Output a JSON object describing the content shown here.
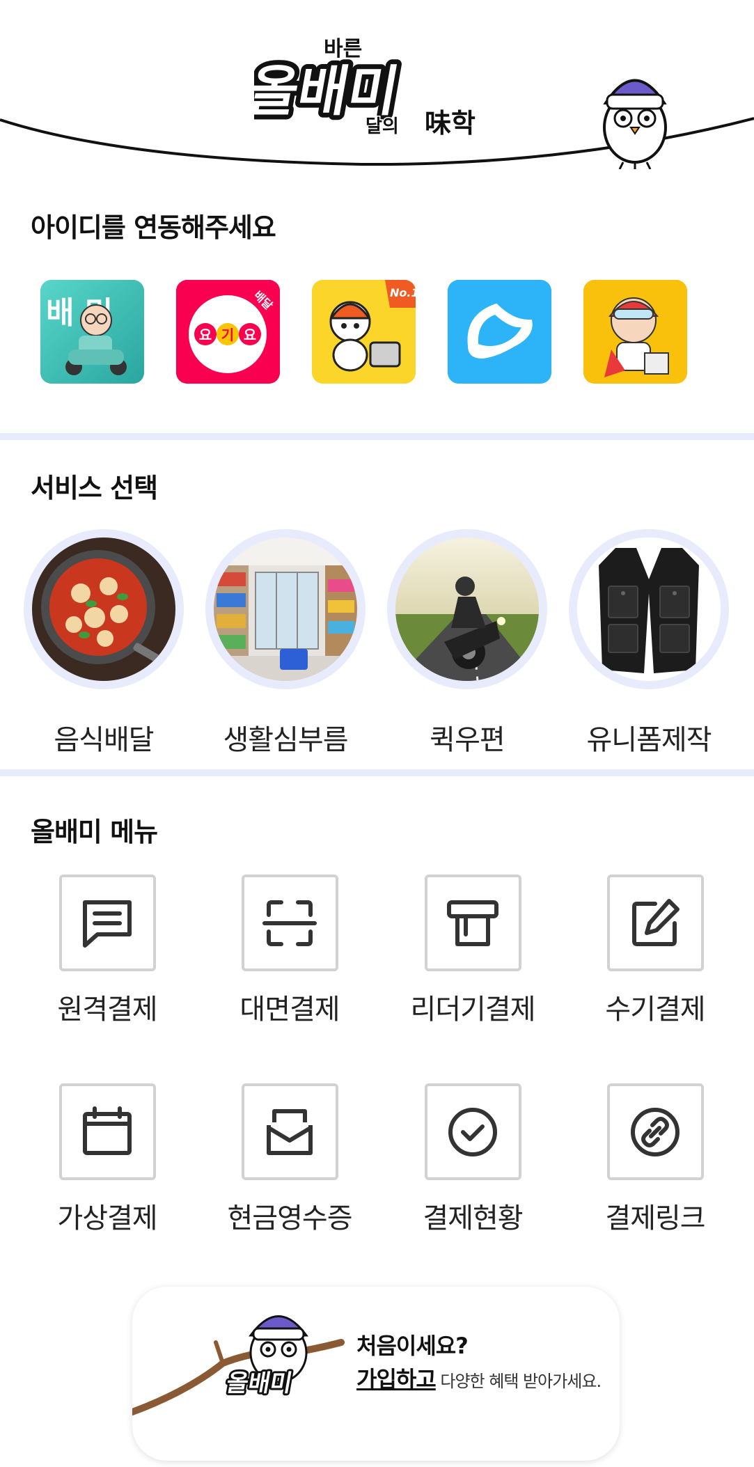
{
  "header": {
    "logo_small_top": "바른",
    "logo_main": "올배미",
    "logo_suffix_small": "달의",
    "logo_suffix_main": "味학"
  },
  "link_section": {
    "title": "아이디를 연동해주세요",
    "apps": [
      {
        "name": "배민",
        "color": "#3ec2b8"
      },
      {
        "name": "요기요",
        "color": "#fa0050"
      },
      {
        "name": "No.1 배달대행",
        "color": "#fbd52a"
      },
      {
        "name": "날개 앱",
        "color": "#2db4f8"
      },
      {
        "name": "캐릭터 앱",
        "color": "#f9c10c"
      }
    ],
    "app_texts": {
      "baemin": "배 민",
      "yogiyo_badge": "배달",
      "yogiyo_letters": [
        "요",
        "기",
        "요"
      ],
      "no1": "No.1"
    }
  },
  "services": {
    "title": "서비스 선택",
    "items": [
      {
        "label": "음식배달",
        "icon": "food-photo"
      },
      {
        "label": "생활심부름",
        "icon": "store-photo"
      },
      {
        "label": "퀵우편",
        "icon": "motorcycle-photo"
      },
      {
        "label": "유니폼제작",
        "icon": "vest-photo"
      }
    ]
  },
  "menu": {
    "title": "올배미 메뉴",
    "items": [
      {
        "label": "원격결제",
        "icon": "chat-icon"
      },
      {
        "label": "대면결제",
        "icon": "scan-icon"
      },
      {
        "label": "리더기결제",
        "icon": "card-reader-icon"
      },
      {
        "label": "수기결제",
        "icon": "edit-icon"
      },
      {
        "label": "가상결제",
        "icon": "calendar-icon"
      },
      {
        "label": "현금영수증",
        "icon": "envelope-icon"
      },
      {
        "label": "결제현황",
        "icon": "check-circle-icon"
      },
      {
        "label": "결제링크",
        "icon": "link-icon"
      }
    ]
  },
  "signup": {
    "question": "처음이세요?",
    "link": "가입하고",
    "description": " 다양한 혜택 받아가세요.",
    "mascot_logo": "올배미"
  },
  "colors": {
    "divider": "#e8ebfb",
    "circle_ring": "#e8ebfb",
    "menu_border": "#d2d2d2",
    "icon": "#333333"
  }
}
